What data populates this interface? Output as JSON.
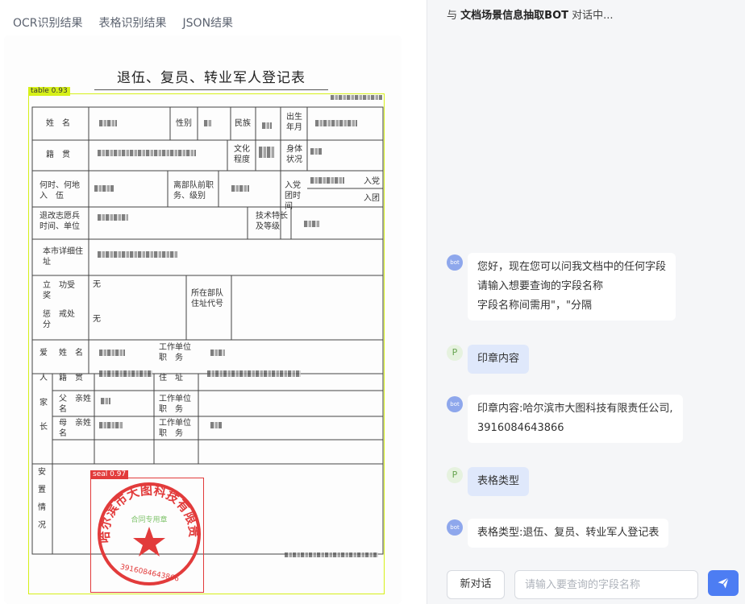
{
  "tabs": [
    "OCR识别结果",
    "表格识别结果",
    "JSON结果"
  ],
  "document": {
    "title": "退伍、复员、转业军人登记表",
    "table_label": "table 0.93",
    "seal_label": "seal 0.97",
    "seal_text_ring": "哈尔滨市大图科技有限责任公司",
    "seal_center": "合同专用章",
    "seal_number": "3916084643866",
    "cells": {
      "name": "姓　名",
      "gender": "性别",
      "ethnicity": "民族",
      "birth": "出生年月",
      "native": "籍　贯",
      "education": "文化程度",
      "health": "身体状况",
      "enlist": "何时、何地入　伍",
      "leave": "离部队前职务、级别",
      "party": "入党团时间",
      "join_party": "入党",
      "join_league": "入团",
      "wish": "退改志愿兵时间、单位",
      "skill": "技术特长及等级",
      "address": "本市详细住址",
      "merit": "立　功受　奖",
      "merit_val": "无",
      "unit_addr": "所在部队住址代号",
      "punish": "惩　戒处　分",
      "punish_val": "无",
      "fam_ai": "爱",
      "fam_ren": "人",
      "fam_jia": "家",
      "fam_zhang": "长",
      "f_name": "姓　名",
      "f_native": "籍　贯",
      "f_father": "父　亲姓　名",
      "f_mother": "母　亲姓　名",
      "f_work1": "工作单位职　务",
      "f_live": "住　址",
      "f_work2": "工作单位职　务",
      "f_work3": "工作单位职　务",
      "placement": "安置情况"
    }
  },
  "chat": {
    "header_prefix": "与",
    "bot_name": "文档场景信息抽取BOT",
    "header_suffix": "对话中...",
    "bot_avatar": "bot",
    "user_avatar": "P",
    "messages": [
      {
        "role": "bot",
        "lines": [
          "您好，现在您可以问我文档中的任何字段",
          "请输入想要查询的字段名称",
          "字段名称间需用\"，\"分隔"
        ]
      },
      {
        "role": "user",
        "lines": [
          "印章内容"
        ]
      },
      {
        "role": "bot",
        "lines": [
          "印章内容:哈尔滨市大图科技有限责任公司,",
          "3916084643866"
        ]
      },
      {
        "role": "user",
        "lines": [
          "表格类型"
        ]
      },
      {
        "role": "bot",
        "lines": [
          "表格类型:退伍、复员、转业军人登记表"
        ]
      }
    ],
    "new_chat": "新对话",
    "input_placeholder": "请输入要查询的字段名称",
    "colors": {
      "accent": "#4d7df3",
      "user_bubble": "#dfe8fb",
      "seal": "#e23b3b",
      "table_box": "#d6f019"
    }
  }
}
